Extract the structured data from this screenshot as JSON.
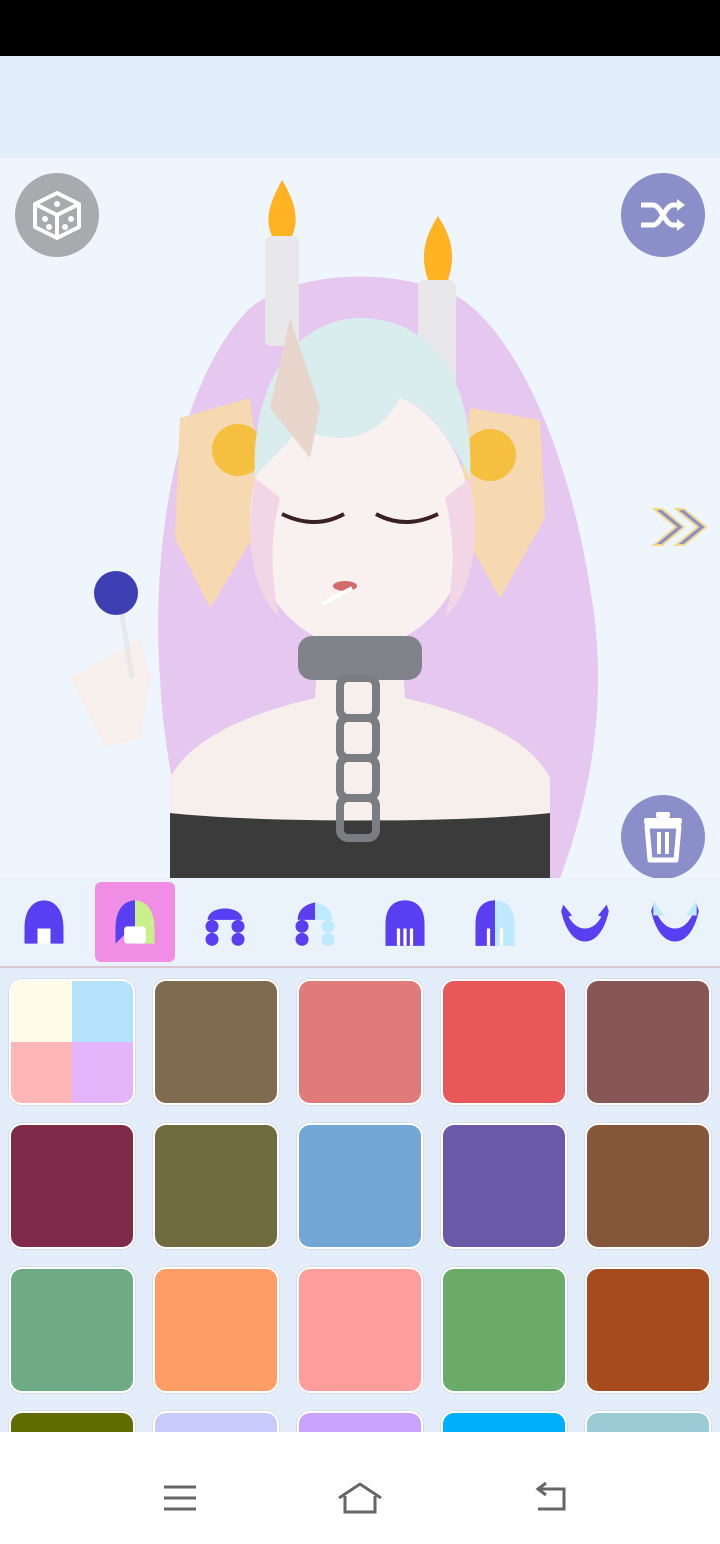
{
  "toolbar": {
    "dice_icon": "dice-icon",
    "shuffle_icon": "shuffle-icon",
    "next_icon": "double-chevron-right-icon",
    "trash_icon": "trash-icon"
  },
  "categories": [
    {
      "icon": "hair-front-icon",
      "selected": false
    },
    {
      "icon": "hair-color-split-icon",
      "selected": true
    },
    {
      "icon": "braids-icon",
      "selected": false
    },
    {
      "icon": "braids-color-icon",
      "selected": false
    },
    {
      "icon": "hair-long-icon",
      "selected": false
    },
    {
      "icon": "hair-long-color-icon",
      "selected": false
    },
    {
      "icon": "horns-icon",
      "selected": false
    },
    {
      "icon": "horns-color-icon",
      "selected": false
    }
  ],
  "swatches": [
    {
      "type": "multi",
      "colors": [
        "#fffbe9",
        "#b4e1fb",
        "#ffb6b6",
        "#e4b4fb"
      ]
    },
    {
      "color": "#7f6c50"
    },
    {
      "color": "#e07b7b"
    },
    {
      "color": "#e85858"
    },
    {
      "color": "#875656"
    },
    {
      "color": "#7f2a49"
    },
    {
      "color": "#6e6c3e"
    },
    {
      "color": "#72a6d5"
    },
    {
      "color": "#6959a7"
    },
    {
      "color": "#85573a"
    },
    {
      "color": "#6eaa85"
    },
    {
      "color": "#ff9d66"
    },
    {
      "color": "#ff9d9d"
    },
    {
      "color": "#6aab6a"
    },
    {
      "color": "#a64b1e"
    },
    {
      "color": "#5f6d00"
    },
    {
      "color": "#c8cafb"
    },
    {
      "color": "#c9a3fc"
    },
    {
      "color": "#00b0ff"
    },
    {
      "color": "#9bccd5"
    }
  ],
  "nav": {
    "menu_icon": "menu-icon",
    "home_icon": "home-icon",
    "back_icon": "back-icon"
  },
  "colors": {
    "accent": "#8b8fc9",
    "icon_purple": "#5a3ff2",
    "selected_tab": "#f08ee6",
    "canvas_bg": "#eef5fc"
  }
}
